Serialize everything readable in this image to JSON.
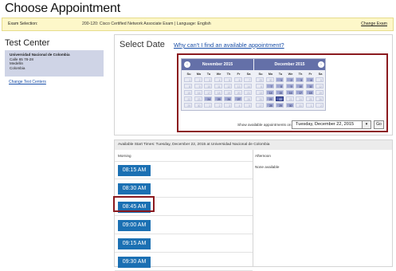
{
  "page": {
    "title": "Choose Appointment"
  },
  "exam": {
    "label": "Exam Selection:",
    "value": "200-120: Cisco Certified Network Associate Exam  |  Language: English",
    "change_label": "Change Exam"
  },
  "test_center": {
    "title": "Test Center",
    "name": "Universidad Nacional de Colombia",
    "address_lines": [
      "Calle 65 78-28",
      "Medellin",
      "Colombia"
    ],
    "change_label": "Change Test Centers"
  },
  "select_date": {
    "title": "Select Date",
    "why_link": "Why can't I find an available appointment?",
    "show_label": "Show available appointments on",
    "selected_date": "Tuesday, December 22, 2015",
    "go_label": "Go"
  },
  "calendar": {
    "prev_icon": "‹",
    "next_icon": "›",
    "weekday_labels": [
      "Su",
      "Mo",
      "Tu",
      "We",
      "Th",
      "Fr",
      "Sa"
    ],
    "months": [
      {
        "name": "November 2015",
        "weeks": [
          [
            "1",
            "2",
            "3",
            "4",
            "5",
            "6",
            "7"
          ],
          [
            "8",
            "9",
            "10",
            "11",
            "12",
            "13",
            "14"
          ],
          [
            "15",
            "16",
            "17",
            "18",
            "19",
            "20",
            "21"
          ],
          [
            "22",
            "23",
            "24",
            "25",
            "26",
            "27",
            "28"
          ],
          [
            "29",
            "30",
            "1",
            "2",
            "3",
            "4",
            "5"
          ]
        ],
        "available": [
          "24",
          "25",
          "26",
          "27"
        ]
      },
      {
        "name": "December 2015",
        "weeks": [
          [
            "29",
            "30",
            "1",
            "2",
            "3",
            "4",
            "5"
          ],
          [
            "6",
            "7",
            "8",
            "9",
            "10",
            "11",
            "12"
          ],
          [
            "13",
            "14",
            "15",
            "16",
            "17",
            "18",
            "19"
          ],
          [
            "20",
            "21",
            "22",
            "23",
            "24",
            "25",
            "26"
          ],
          [
            "27",
            "28",
            "29",
            "30",
            "31",
            "1",
            "2"
          ]
        ],
        "available": [
          "1",
          "2",
          "3",
          "4",
          "7",
          "8",
          "9",
          "10",
          "11",
          "14",
          "15",
          "16",
          "17",
          "18",
          "21",
          "22",
          "28",
          "29",
          "30"
        ],
        "selected": "22"
      }
    ]
  },
  "times": {
    "header": "Available Start Times: Tuesday, December 22, 2015 at Universidad Nacional de Colombia",
    "morning_label": "Morning",
    "afternoon_label": "Afternoon",
    "afternoon_none": "None available",
    "morning_slots": [
      "08:15 AM",
      "08:30 AM",
      "08:45 AM",
      "09:00 AM",
      "09:15 AM",
      "09:30 AM"
    ],
    "highlighted_slot": "08:45 AM"
  },
  "colors": {
    "highlight": "#8b1a1f",
    "button": "#1b70b3",
    "calendar_header": "#6470a8"
  }
}
